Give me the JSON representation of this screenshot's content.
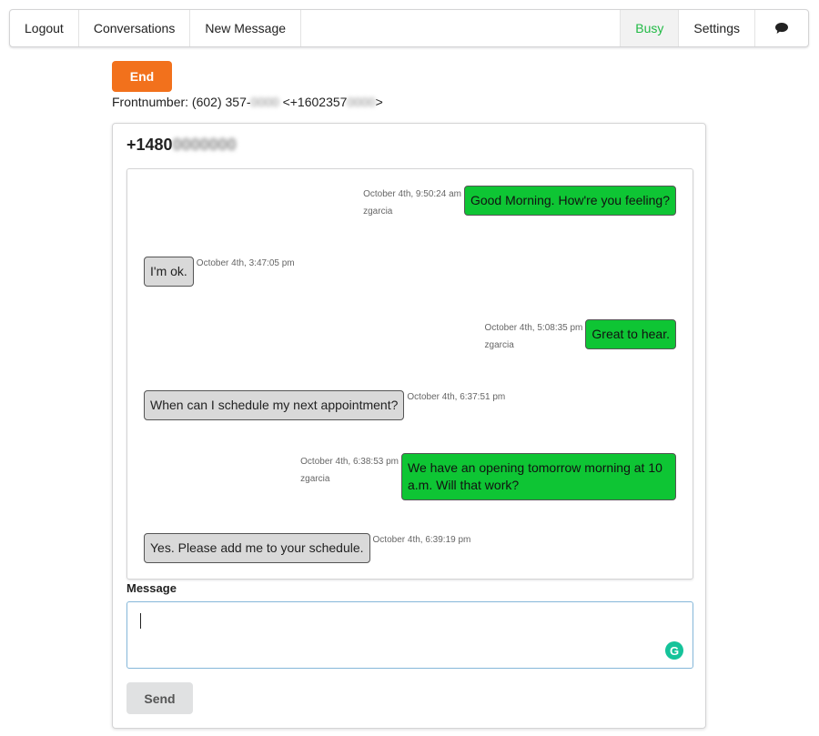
{
  "nav": {
    "logout": "Logout",
    "conversations": "Conversations",
    "new_message": "New Message",
    "busy": "Busy",
    "settings": "Settings",
    "chat_icon": "speech-bubble-icon"
  },
  "end_button": "End",
  "frontnumber": {
    "prefix": "Frontnumber: (602) 357-",
    "masked1": "0000",
    "middle": " <+1602357",
    "masked2": "0000",
    "suffix": ">"
  },
  "conversation": {
    "number_prefix": "+1480",
    "number_masked": "0000000"
  },
  "messages": [
    {
      "direction": "out",
      "text": "Good Morning. How're you feeling?",
      "timestamp": "October 4th, 9:50:24 am",
      "sender": "zgarcia"
    },
    {
      "direction": "in",
      "text": "I'm ok.",
      "timestamp": "October 4th, 3:47:05 pm"
    },
    {
      "direction": "out",
      "text": "Great to hear.",
      "timestamp": "October 4th, 5:08:35 pm",
      "sender": "zgarcia"
    },
    {
      "direction": "in",
      "text": "When can I schedule my next appointment?",
      "timestamp": "October 4th, 6:37:51 pm"
    },
    {
      "direction": "out",
      "text": "We have an opening tomorrow morning at 10 a.m. Will that work?",
      "timestamp": "October 4th, 6:38:53 pm",
      "sender": "zgarcia"
    },
    {
      "direction": "in",
      "text": "Yes. Please add me to your schedule.",
      "timestamp": "October 4th, 6:39:19 pm"
    }
  ],
  "composer": {
    "label": "Message",
    "value": "",
    "grammarly_letter": "G"
  },
  "send_button": "Send",
  "colors": {
    "end": "#f2711c",
    "busy": "#21ba45",
    "outgoing": "#0ec534",
    "incoming": "#d9d9d9",
    "input_border": "#85b7d9"
  }
}
